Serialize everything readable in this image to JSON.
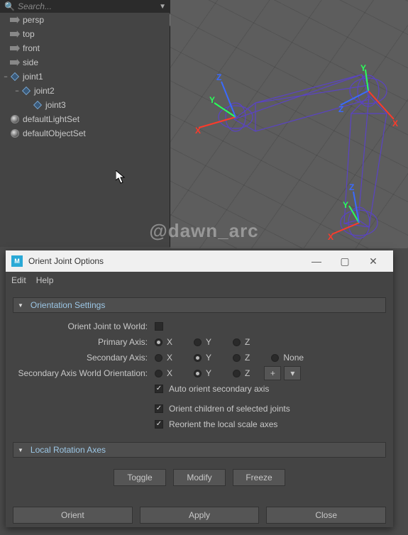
{
  "search": {
    "placeholder": "Search..."
  },
  "outliner": {
    "items": [
      {
        "label": "persp",
        "type": "cam",
        "indent": 1
      },
      {
        "label": "top",
        "type": "cam",
        "indent": 1
      },
      {
        "label": "front",
        "type": "cam",
        "indent": 1
      },
      {
        "label": "side",
        "type": "cam",
        "indent": 1
      },
      {
        "label": "joint1",
        "type": "joint",
        "indent": 1,
        "exp": "−"
      },
      {
        "label": "joint2",
        "type": "joint",
        "indent": 2,
        "exp": "−"
      },
      {
        "label": "joint3",
        "type": "joint",
        "indent": 3
      },
      {
        "label": "defaultLightSet",
        "type": "set",
        "indent": 1
      },
      {
        "label": "defaultObjectSet",
        "type": "set",
        "indent": 1
      }
    ]
  },
  "watermark": "@dawn_arc",
  "viewport": {
    "axis_labels": {
      "x": "X",
      "y": "Y",
      "z": "Z"
    },
    "axis_colors": {
      "x": "#ff3a2a",
      "y": "#2aff5a",
      "z": "#3a6aff"
    }
  },
  "dialog": {
    "title": "Orient Joint Options",
    "menu": {
      "edit": "Edit",
      "help": "Help"
    },
    "sections": {
      "orientation": "Orientation Settings",
      "local_rot": "Local Rotation Axes"
    },
    "form": {
      "to_world": {
        "label": "Orient Joint to World:",
        "checked": false
      },
      "primary": {
        "label": "Primary Axis:",
        "options": [
          "X",
          "Y",
          "Z"
        ],
        "selected": "X"
      },
      "secondary": {
        "label": "Secondary Axis:",
        "options": [
          "X",
          "Y",
          "Z",
          "None"
        ],
        "selected": "Y"
      },
      "secondary_world": {
        "label": "Secondary Axis World Orientation:",
        "options": [
          "X",
          "Y",
          "Z"
        ],
        "selected": "Y",
        "plus": "+",
        "chev": "▾"
      },
      "auto_orient": {
        "label": "Auto orient secondary axis",
        "checked": true
      },
      "orient_children": {
        "label": "Orient children of selected joints",
        "checked": true
      },
      "reorient_scale": {
        "label": "Reorient the local scale axes",
        "checked": true
      }
    },
    "local_rot_buttons": {
      "toggle": "Toggle",
      "modify": "Modify",
      "freeze": "Freeze"
    },
    "bottom": {
      "orient": "Orient",
      "apply": "Apply",
      "close": "Close"
    }
  }
}
